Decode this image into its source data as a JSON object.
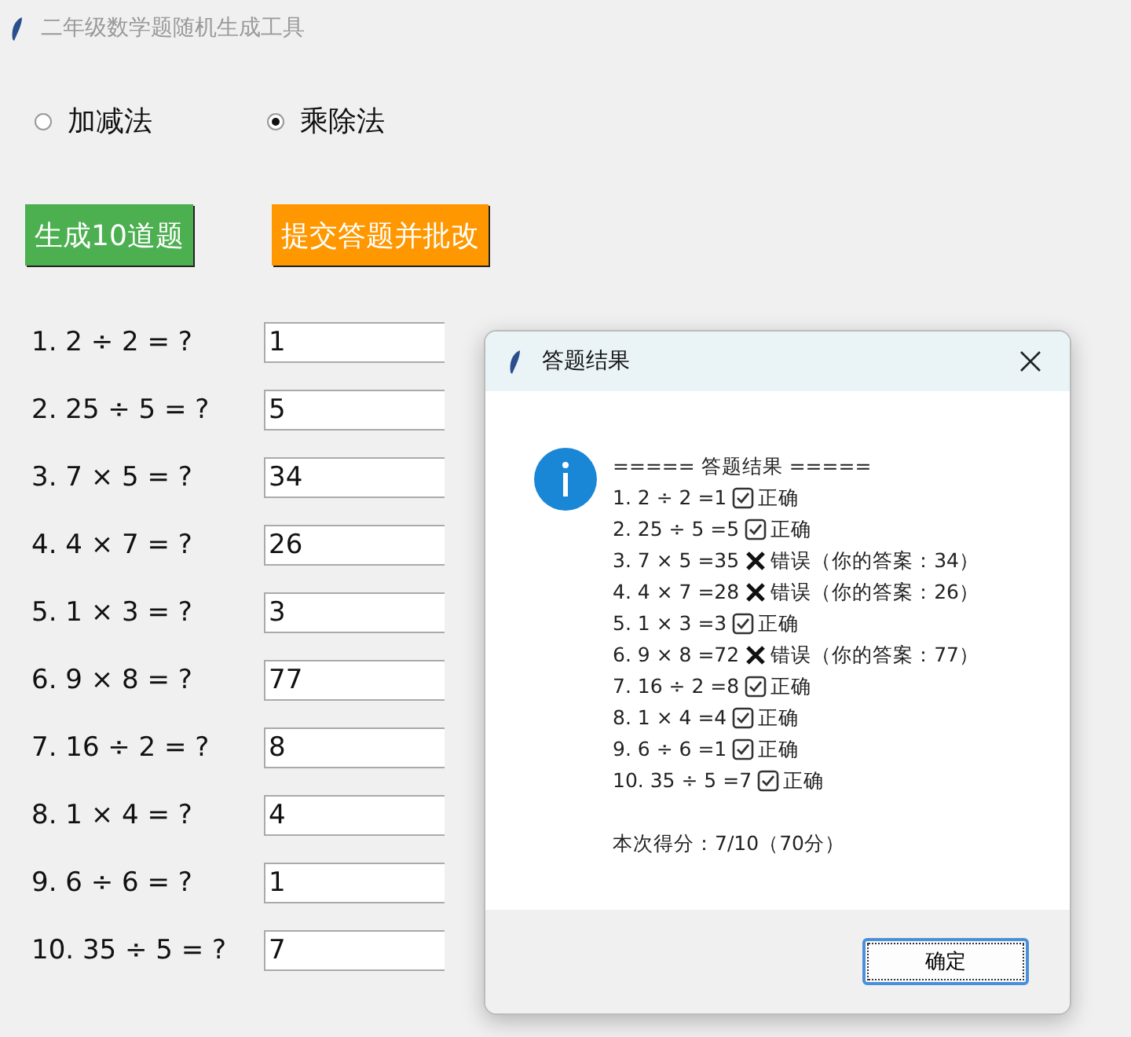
{
  "window": {
    "title": "二年级数学题随机生成工具"
  },
  "modes": [
    {
      "label": "加减法",
      "selected": false
    },
    {
      "label": "乘除法",
      "selected": true
    }
  ],
  "buttons": [
    {
      "label": "生成10道题",
      "kind": "generate"
    },
    {
      "label": "提交答题并批改",
      "kind": "submit"
    }
  ],
  "questions": [
    {
      "text": "1. 2 ÷ 2 = ?",
      "answer": "1"
    },
    {
      "text": "2. 25 ÷ 5 = ?",
      "answer": "5"
    },
    {
      "text": "3. 7 × 5 = ?",
      "answer": "34"
    },
    {
      "text": "4. 4 × 7 = ?",
      "answer": "26"
    },
    {
      "text": "5. 1 × 3 = ?",
      "answer": "3"
    },
    {
      "text": "6. 9 × 8 = ?",
      "answer": "77"
    },
    {
      "text": "7. 16 ÷ 2 = ?",
      "answer": "8"
    },
    {
      "text": "8. 1 × 4 = ?",
      "answer": "4"
    },
    {
      "text": "9. 6 ÷ 6 = ?",
      "answer": "1"
    },
    {
      "text": "10. 35 ÷ 5 = ?",
      "answer": "7"
    }
  ],
  "dialog": {
    "title": "答题结果",
    "heading": "===== 答题结果 =====",
    "lines": [
      {
        "text": "1. 2 ÷ 2 =1",
        "correct": true,
        "verdict": "正确"
      },
      {
        "text": "2. 25 ÷ 5 =5",
        "correct": true,
        "verdict": "正确"
      },
      {
        "text": "3. 7 × 5 =35",
        "correct": false,
        "verdict": "错误（你的答案：34）"
      },
      {
        "text": "4. 4 × 7 =28",
        "correct": false,
        "verdict": "错误（你的答案：26）"
      },
      {
        "text": "5. 1 × 3 =3",
        "correct": true,
        "verdict": "正确"
      },
      {
        "text": "6. 9 × 8 =72",
        "correct": false,
        "verdict": "错误（你的答案：77）"
      },
      {
        "text": "7. 16 ÷ 2 =8",
        "correct": true,
        "verdict": "正确"
      },
      {
        "text": "8. 1 × 4 =4",
        "correct": true,
        "verdict": "正确"
      },
      {
        "text": "9. 6 ÷ 6 =1",
        "correct": true,
        "verdict": "正确"
      },
      {
        "text": "10. 35 ÷ 5 =7",
        "correct": true,
        "verdict": "正确"
      }
    ],
    "score": "本次得分：7/10（70分）",
    "ok_button": "确定"
  }
}
